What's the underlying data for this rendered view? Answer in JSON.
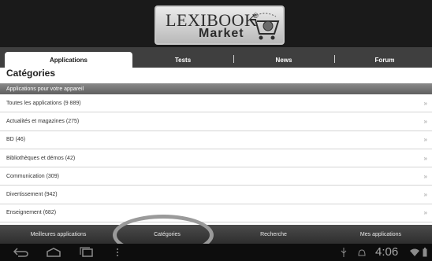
{
  "header": {
    "logo_name": "LEXIBOOK",
    "logo_reg": "®",
    "logo_market": "Market"
  },
  "tabs": [
    {
      "label": "Applications",
      "active": true
    },
    {
      "label": "Tests",
      "active": false
    },
    {
      "label": "News",
      "active": false
    },
    {
      "label": "Forum",
      "active": false
    }
  ],
  "page_title": "Catégories",
  "section_header": "Applications pour votre appareil",
  "categories": [
    "Toutes les applications (9 889)",
    "Actualités et magazines (275)",
    "BD (46)",
    "Bibliothèques et démos (42)",
    "Communication (309)",
    "Divertissement (942)",
    "Enseignement (682)"
  ],
  "row_chevron": "»",
  "bottom_nav": [
    "Meilleures applications",
    "Catégories",
    "Recherche",
    "Mes applications"
  ],
  "status_bar": {
    "time": "4:06",
    "icons": [
      "back-icon",
      "home-icon",
      "recent-apps-icon",
      "menu-icon",
      "usb-icon",
      "android-debug-icon",
      "wifi-icon",
      "battery-icon"
    ]
  },
  "colors": {
    "topbar": "#1a1a1a",
    "tabbar": "#3f3f3f",
    "section": "#6e6e6e",
    "highlight_circle": "#9a9a9a"
  }
}
